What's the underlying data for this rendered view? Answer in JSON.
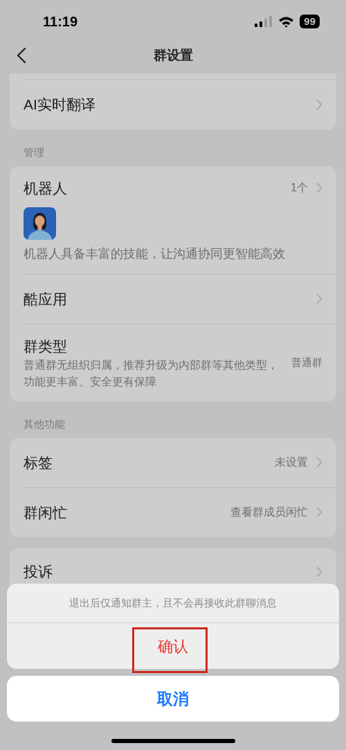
{
  "status_bar": {
    "time": "11:19",
    "battery": "99"
  },
  "nav": {
    "title": "群设置"
  },
  "top_card": {
    "items": [
      {
        "label": "AI实时翻译"
      }
    ]
  },
  "sections": [
    {
      "title": "管理",
      "items": [
        {
          "kind": "bot",
          "label": "机器人",
          "value": "1个",
          "description": "机器人具备丰富的技能，让沟通协同更智能高效"
        },
        {
          "kind": "link",
          "label": "酷应用"
        },
        {
          "kind": "type",
          "label": "群类型",
          "description": "普通群无组织归属，推荐升级为内部群等其他类型，功能更丰富、安全更有保障",
          "value": "普通群"
        }
      ]
    },
    {
      "title": "其他功能",
      "items": [
        {
          "kind": "link",
          "label": "标签",
          "value": "未设置"
        },
        {
          "kind": "link",
          "label": "群闲忙",
          "value": "查看群成员闲忙"
        }
      ]
    }
  ],
  "bottom_card": {
    "items": [
      {
        "label": "投诉"
      }
    ]
  },
  "action_sheet": {
    "message": "退出后仅通知群主，且不会再接收此群聊消息",
    "confirm": "确认",
    "cancel": "取消",
    "confirm_highlighted": true
  }
}
